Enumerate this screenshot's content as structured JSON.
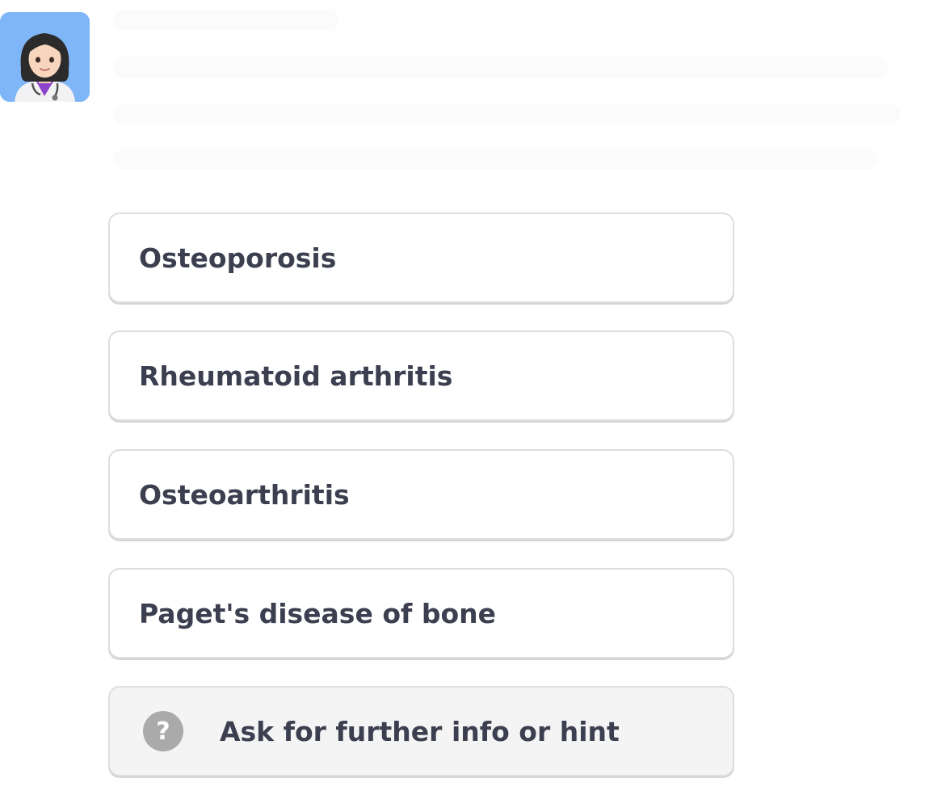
{
  "avatar": {
    "icon": "doctor-avatar-icon",
    "background": "#7fb6f7"
  },
  "options": [
    {
      "label": "Osteoporosis"
    },
    {
      "label": "Rheumatoid arthritis"
    },
    {
      "label": "Osteoarthritis"
    },
    {
      "label": "Paget's disease of bone"
    }
  ],
  "hint": {
    "label": "Ask for further info or hint",
    "icon": "question-mark-icon",
    "icon_glyph": "?"
  },
  "colors": {
    "option_text": "#3b3f4f",
    "option_border": "#dedee2",
    "hint_background": "#f4f4f5",
    "hint_icon": "#aaaaaa"
  }
}
